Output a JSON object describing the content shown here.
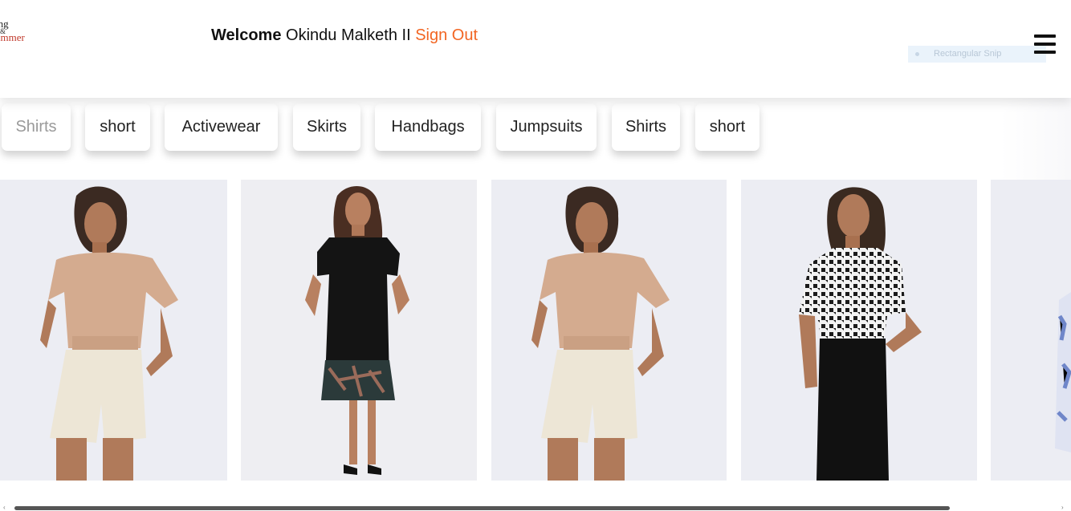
{
  "logo": {
    "line1": "ing",
    "line2": "&",
    "line3": "ummer"
  },
  "header": {
    "welcome_label": "Welcome",
    "user_name": "Okindu Malketh II",
    "sign_out": "Sign Out"
  },
  "snip_overlay": {
    "label": "Rectangular Snip"
  },
  "categories": [
    "Shirts",
    "short",
    "Activewear",
    "Skirts",
    "Handbags",
    "Jumpsuits",
    "Shirts",
    "short"
  ],
  "products": [
    {
      "desc": "woman in beige short-sleeve top and cream shorts"
    },
    {
      "desc": "woman in black dress with printed hem"
    },
    {
      "desc": "woman in beige short-sleeve top and cream shorts"
    },
    {
      "desc": "woman in houndstooth blouse and black pencil skirt"
    },
    {
      "desc": "partially visible blue patterned outfit"
    }
  ],
  "colors": {
    "accent": "#f26522",
    "card_bg": "#ecedf3"
  }
}
